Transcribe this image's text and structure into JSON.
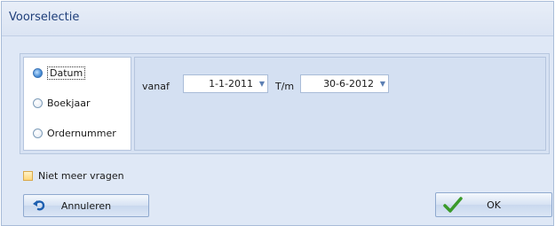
{
  "window": {
    "title": "Voorselectie"
  },
  "selection": {
    "options": [
      {
        "label": "Datum",
        "checked": true
      },
      {
        "label": "Boekjaar",
        "checked": false
      },
      {
        "label": "Ordernummer",
        "checked": false
      }
    ]
  },
  "dates": {
    "from_label": "vanaf",
    "from_value": "1-1-2011",
    "to_label": "T/m",
    "to_value": "30-6-2012"
  },
  "options": {
    "no_more_ask_label": "Niet meer vragen",
    "no_more_ask_checked": false
  },
  "buttons": {
    "cancel_label": "Annuleren",
    "ok_label": "OK"
  },
  "icons": {
    "cancel": "undo-arrow-icon",
    "ok": "checkmark-icon",
    "dropdown": "chevron-down-icon"
  },
  "colors": {
    "window_bg": "#dfe8f6",
    "title_text": "#1f3f7a",
    "ok_check": "#3a9a2b"
  }
}
